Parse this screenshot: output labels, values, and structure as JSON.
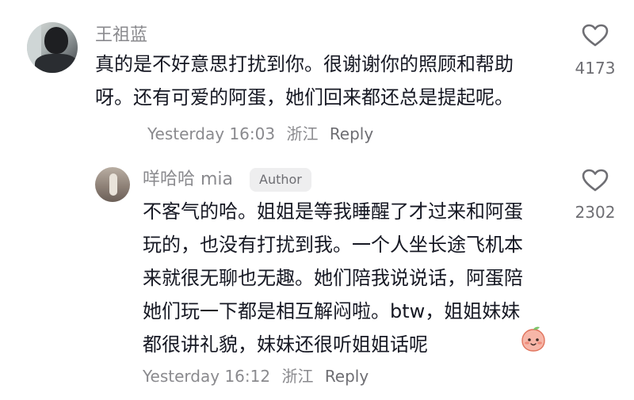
{
  "comment": {
    "username": "王祖蓝",
    "text": "真的是不好意思打扰到你。很谢谢你的照顾和帮助呀。还有可爱的阿蛋，她们回来都还总是提起呢。",
    "date": "Yesterday 16:03",
    "location": "浙江",
    "reply_label": "Reply",
    "likes": "4173"
  },
  "reply": {
    "username": "咩哈哈 mia",
    "badge": "Author",
    "text": "不客气的哈。姐姐是等我睡醒了才过来和阿蛋玩的，也没有打扰到我。一个人坐长途飞机本来就很无聊也无趣。她们陪我说说话，阿蛋陪她们玩一下都是相互解闷啦。btw，姐姐妹妹都很讲礼貌，妹妹还很听姐姐话呢",
    "date": "Yesterday 16:12",
    "location": "浙江",
    "reply_label": "Reply",
    "likes": "2302"
  },
  "icons": {
    "like": "heart-outline-icon",
    "emoji": "peach-face-emoji"
  },
  "colors": {
    "text_primary": "#161823",
    "text_secondary": "#8a8a8e",
    "badge_bg": "#eeeeef"
  }
}
